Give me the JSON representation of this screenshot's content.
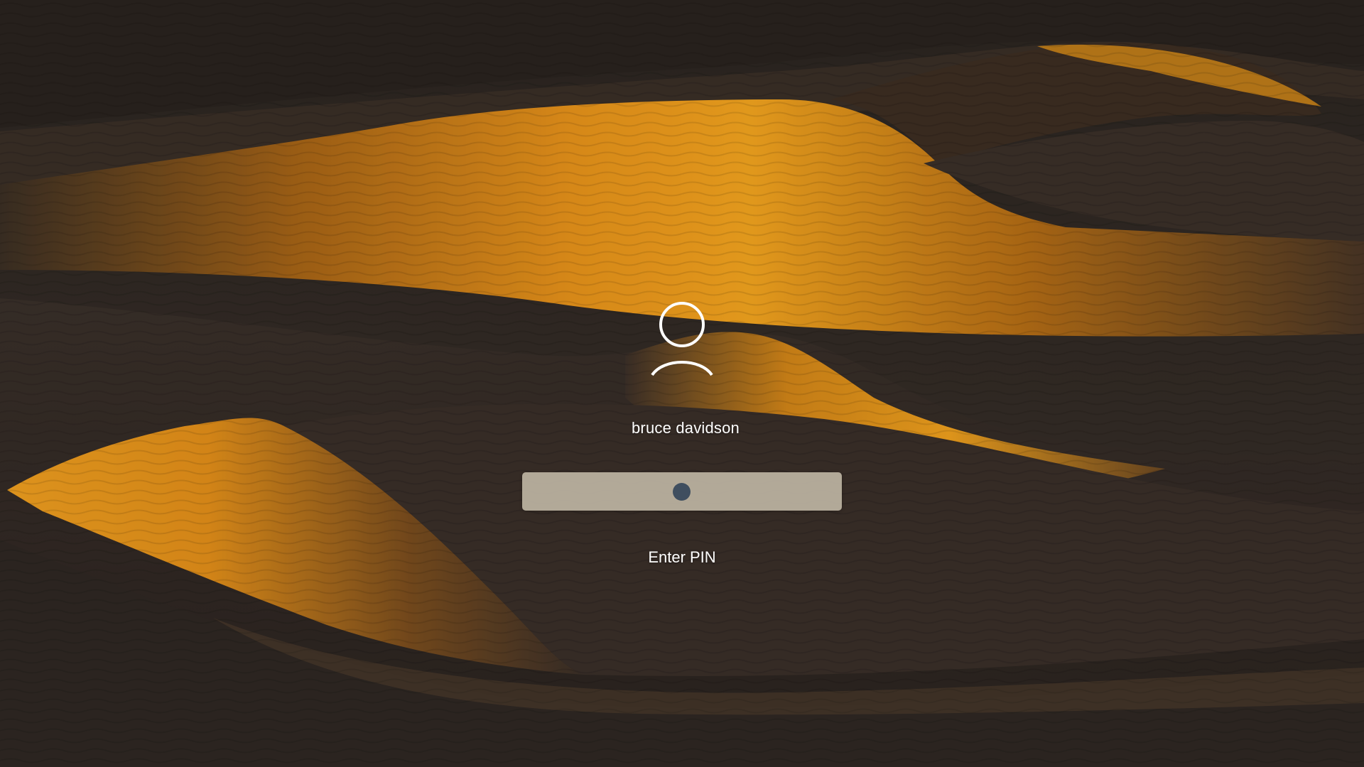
{
  "lock_screen": {
    "wallpaper_name": "desert-dunes",
    "user": {
      "name": "bruce davidson",
      "avatar_icon": "user-avatar-icon"
    },
    "pin": {
      "entered_digits": 1,
      "hint": "Enter PIN"
    },
    "colors": {
      "text": "#ffffff",
      "pin_field": "#cec6b2",
      "pin_dot": "#3f4e5f",
      "dune_glow": "#f7a21c",
      "dune_shadow": "#2f2823"
    }
  }
}
